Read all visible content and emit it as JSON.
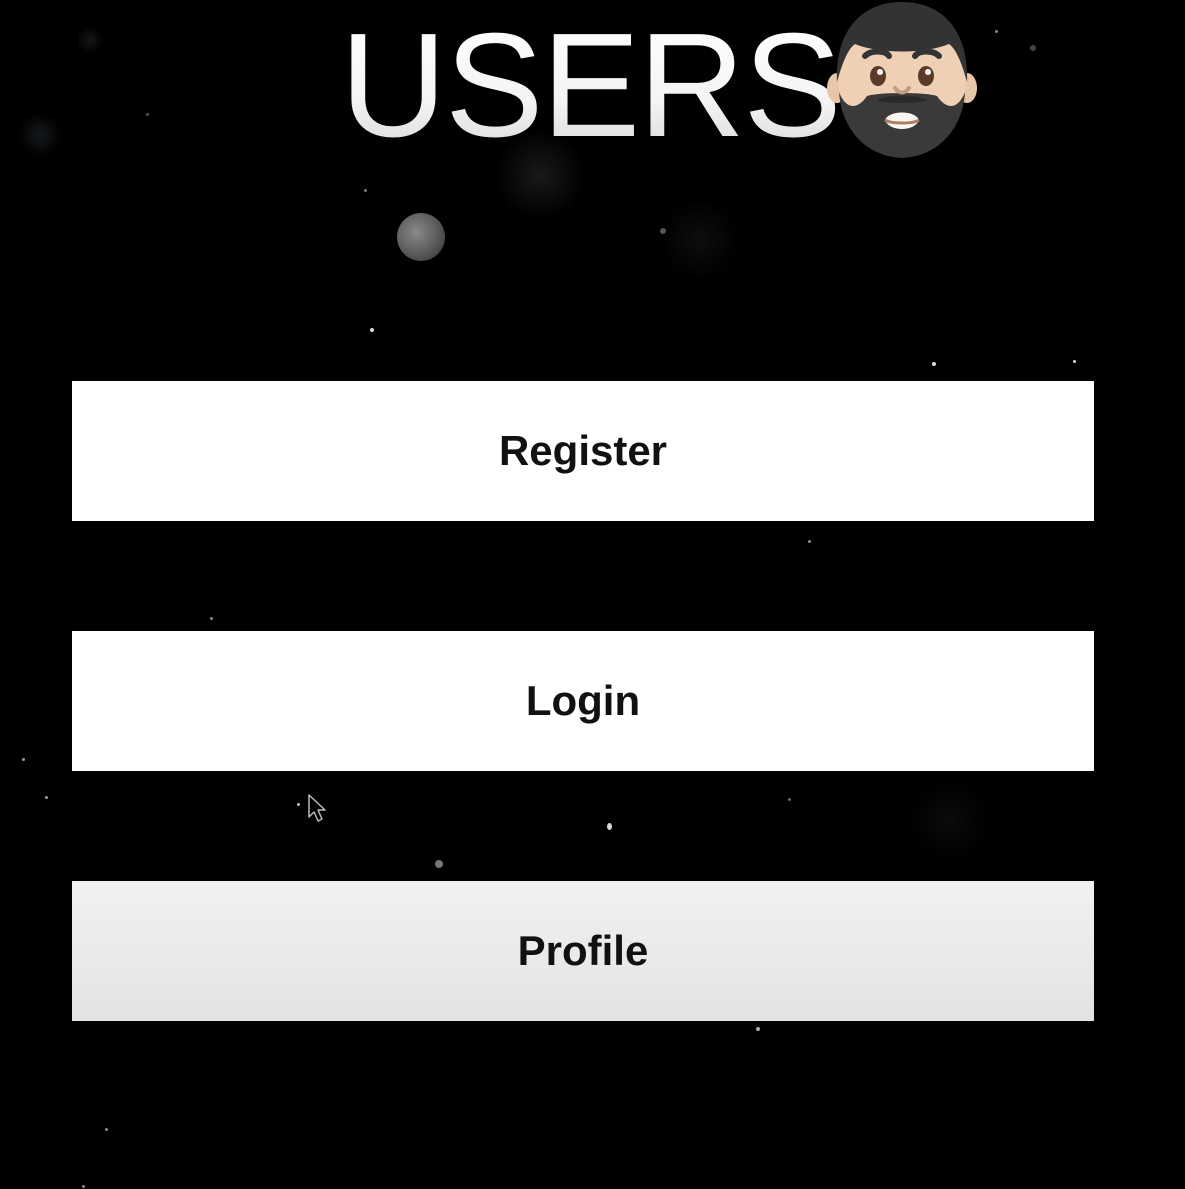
{
  "header": {
    "title": "USERS",
    "avatar_icon": "bearded-man-emoji-icon"
  },
  "buttons": {
    "register_label": "Register",
    "login_label": "Login",
    "profile_label": "Profile"
  },
  "colors": {
    "background": "#000000",
    "button_background": "#ffffff",
    "button_text": "#111111",
    "title_text": "#ffffff"
  }
}
